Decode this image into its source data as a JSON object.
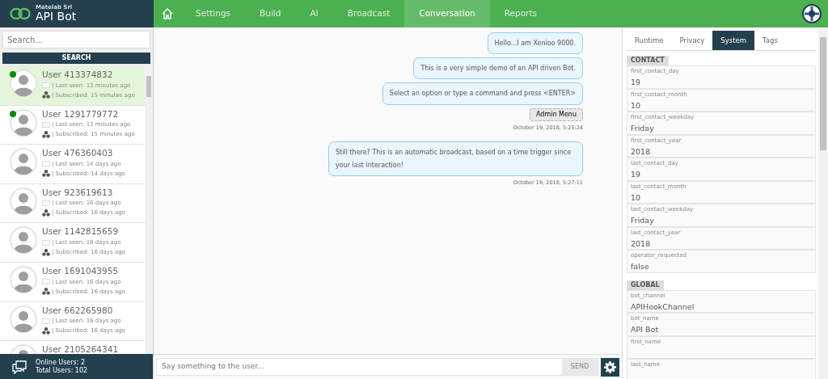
{
  "brand": {
    "company": "Matelab Srl",
    "product": "API Bot"
  },
  "nav": [
    {
      "kind": "home",
      "selected": false
    },
    {
      "label": "Settings",
      "selected": false
    },
    {
      "label": "Build",
      "selected": false
    },
    {
      "label": "AI",
      "selected": false
    },
    {
      "label": "Broadcast",
      "selected": false
    },
    {
      "label": "Conversation",
      "selected": true
    },
    {
      "label": "Reports",
      "selected": false
    }
  ],
  "search": {
    "placeholder": "Search...",
    "button": "SEARCH"
  },
  "users": [
    {
      "name": "User 413374832",
      "last_seen": "| Last seen: 13 minutes ago",
      "subscribed": "| Subscribed: 15 minutes ago",
      "online": true,
      "selected": true
    },
    {
      "name": "User 1291779772",
      "last_seen": "| Last seen: 13 minutes ago",
      "subscribed": "| Subscribed: 15 minutes ago",
      "online": true,
      "selected": false
    },
    {
      "name": "User 476360403",
      "last_seen": "| Last seen: 14 days ago",
      "subscribed": "| Subscribed: 14 days ago",
      "online": false,
      "selected": false
    },
    {
      "name": "User 923619613",
      "last_seen": "| Last seen: 16 days ago",
      "subscribed": "| Subscribed: 16 days ago",
      "online": false,
      "selected": false
    },
    {
      "name": "User 1142815659",
      "last_seen": "| Last seen: 16 days ago",
      "subscribed": "| Subscribed: 16 days ago",
      "online": false,
      "selected": false
    },
    {
      "name": "User 1691043955",
      "last_seen": "| Last seen: 16 days ago",
      "subscribed": "| Subscribed: 16 days ago",
      "online": false,
      "selected": false
    },
    {
      "name": "User 662265980",
      "last_seen": "| Last seen: 16 days ago",
      "subscribed": "| Subscribed: 16 days ago",
      "online": false,
      "selected": false
    },
    {
      "name": "User 2105264341",
      "online": false,
      "selected": false
    }
  ],
  "stats": {
    "online": "Online Users: 2",
    "total": "Total Users: 102"
  },
  "messages": [
    {
      "kind": "bubble",
      "text": "Hello...I am Xenioo 9000."
    },
    {
      "kind": "bubble",
      "text": "This is a very simple demo of an API driven Bot."
    },
    {
      "kind": "bubble",
      "text": "Select an option or type a command and press <ENTER>"
    },
    {
      "kind": "quick-reply",
      "text": "Admin Menu"
    },
    {
      "kind": "time",
      "text": "October 19, 2018, 5:25:24"
    },
    {
      "kind": "bubble",
      "text": "Still there? This is an automatic broadcast, based on a time trigger since your last interaction!"
    },
    {
      "kind": "time",
      "text": "October 19, 2018, 5:27:11"
    }
  ],
  "composer": {
    "placeholder": "Say something to the user...",
    "send": "SEND"
  },
  "tabs": [
    {
      "label": "Runtime",
      "selected": false
    },
    {
      "label": "Privacy",
      "selected": false
    },
    {
      "label": "System",
      "selected": true
    },
    {
      "label": "Tags",
      "selected": false
    }
  ],
  "sections": [
    {
      "title": "CONTACT",
      "fields": [
        {
          "key": "first_contact_day",
          "value": "19"
        },
        {
          "key": "first_contact_month",
          "value": "10"
        },
        {
          "key": "first_contact_weekday",
          "value": "Friday"
        },
        {
          "key": "first_contact_year",
          "value": "2018"
        },
        {
          "key": "last_contact_day",
          "value": "19"
        },
        {
          "key": "last_contact_month",
          "value": "10"
        },
        {
          "key": "last_contact_weekday",
          "value": "Friday"
        },
        {
          "key": "last_contact_year",
          "value": "2018"
        },
        {
          "key": "operator_requested",
          "value": "false"
        }
      ]
    },
    {
      "title": "GLOBAL",
      "fields": [
        {
          "key": "bot_channel",
          "value": "APIHookChannel"
        },
        {
          "key": "bot_name",
          "value": "API Bot"
        },
        {
          "key": "first_name"
        },
        {
          "key": "last_name"
        }
      ]
    }
  ]
}
